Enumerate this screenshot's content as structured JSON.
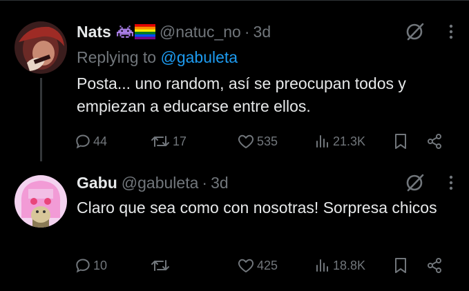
{
  "tweets": [
    {
      "author": {
        "name": "Nats",
        "handle": "@natuc_no",
        "badges": [
          "space-invader-emoji",
          "rainbow-flag-emoji"
        ]
      },
      "time": "3d",
      "separator": "·",
      "replying_prefix": "Replying to ",
      "replying_to": "@gabuleta",
      "text": "Posta... uno random, así se preocupan todos y empiezan a educarse entre ellos.",
      "stats": {
        "replies": "44",
        "retweets": "17",
        "likes": "535",
        "views": "21.3K"
      }
    },
    {
      "author": {
        "name": "Gabu",
        "handle": "@gabuleta",
        "badges": []
      },
      "time": "3d",
      "separator": "·",
      "text": "Claro que sea como con nosotras! Sorpresa chicos",
      "stats": {
        "replies": "10",
        "retweets": "",
        "likes": "425",
        "views": "18.8K"
      }
    }
  ],
  "colors": {
    "text": "#e7e9ea",
    "muted": "#71767b",
    "link": "#1d9bf0",
    "background": "#000000",
    "divider": "#2f3336"
  }
}
